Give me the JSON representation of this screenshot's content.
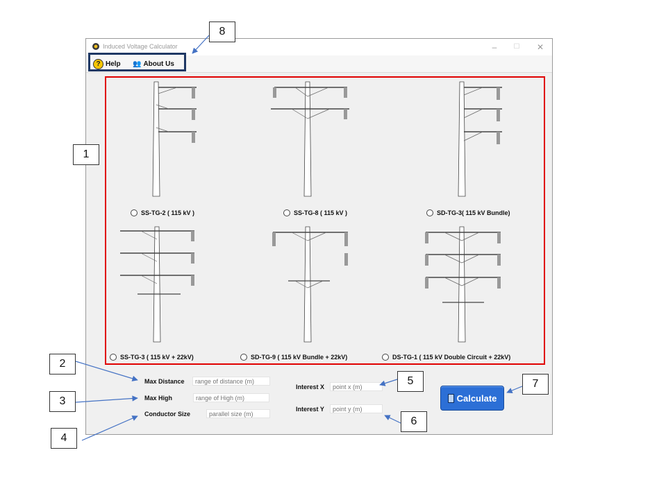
{
  "window": {
    "title": "Induced Voltage Calculator",
    "controls": {
      "minimize": "–",
      "maximize": "☐",
      "close": "✕"
    }
  },
  "menu": {
    "help": "Help",
    "help_icon_glyph": "?",
    "about": "About Us",
    "about_icon_glyph": "👥"
  },
  "towers": [
    {
      "id": "ss-tg-2",
      "label": "SS-TG-2 ( 115 kV )"
    },
    {
      "id": "ss-tg-8",
      "label": "SS-TG-8 ( 115 kV )"
    },
    {
      "id": "sd-tg-3",
      "label": "SD-TG-3( 115 kV Bundle)"
    },
    {
      "id": "ss-tg-3",
      "label": "SS-TG-3 ( 115 kV + 22kV)"
    },
    {
      "id": "sd-tg-9",
      "label": "SD-TG-9 ( 115 kV Bundle + 22kV)"
    },
    {
      "id": "ds-tg-1",
      "label": "DS-TG-1 ( 115 kV Double Circuit  + 22kV)"
    }
  ],
  "form": {
    "max_distance": {
      "label": "Max Distance",
      "placeholder": "range of distance (m)"
    },
    "max_high": {
      "label": "Max High",
      "placeholder": "range of High (m)"
    },
    "conductor_size": {
      "label": "Conductor Size",
      "placeholder": "parallel size (m)"
    },
    "interest_x": {
      "label": "Interest X",
      "placeholder": "point x (m)"
    },
    "interest_y": {
      "label": "Interest Y",
      "placeholder": "point y (m)"
    }
  },
  "calculate": {
    "label": "Calculate"
  },
  "callouts": [
    "1",
    "2",
    "3",
    "4",
    "5",
    "6",
    "7",
    "8"
  ],
  "colors": {
    "highlight_red": "#e00000",
    "menu_box": "#1f3864",
    "button_blue": "#2c6fd6",
    "arrow": "#4472c4"
  }
}
